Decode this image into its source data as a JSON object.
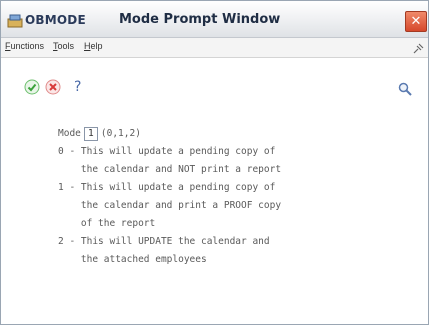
{
  "titlebar": {
    "app_name": "OBMODE",
    "title": "Mode Prompt Window"
  },
  "menu": [
    {
      "label": "Functions",
      "accel": "F"
    },
    {
      "label": "Tools",
      "accel": "T"
    },
    {
      "label": "Help",
      "accel": "H"
    }
  ],
  "toolbar": {
    "help_symbol": "?"
  },
  "form": {
    "mode_label": "Mode",
    "mode_value": "1",
    "mode_options": "(0,1,2)"
  },
  "description_lines": [
    "0 - This will update a pending copy of",
    "    the calendar and NOT print a report",
    "1 - This will update a pending copy of",
    "    the calendar and print a PROOF copy",
    "    of the report",
    "2 - This will UPDATE the calendar and",
    "    the attached employees"
  ],
  "colors": {
    "close_button": "#d6482b",
    "ok_icon": "#3aa23a",
    "cancel_icon": "#d83a3a",
    "text": "#5a5a5a"
  },
  "icons": {
    "app": "app-icon",
    "close": "close-icon",
    "ok": "check-icon",
    "cancel": "cancel-icon",
    "help": "help-icon",
    "search": "search-icon",
    "menu_right": "pin-icon"
  }
}
